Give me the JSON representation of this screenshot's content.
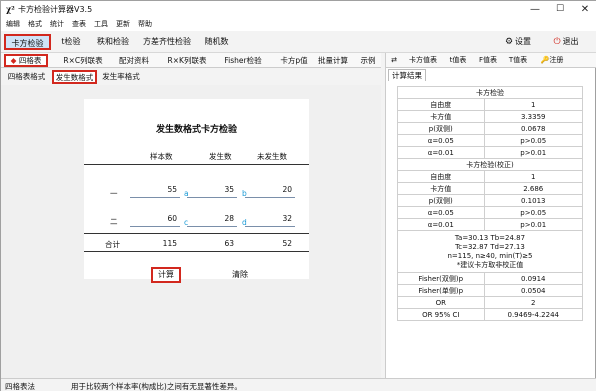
{
  "window": {
    "title": "卡方检验计算器V3.5",
    "icon": "χ²"
  },
  "menu": [
    "编辑",
    "格式",
    "统计",
    "查表",
    "工具",
    "更新",
    "帮助"
  ],
  "toolbar": {
    "tabs": [
      "卡方检验",
      "t检验",
      "秩和检验",
      "方差齐性检验",
      "随机数"
    ],
    "settings": "设置",
    "exit": "退出"
  },
  "subtabs": [
    "四格表",
    "R×C列联表",
    "配对资料",
    "R×K列联表",
    "Fisher检验",
    "卡方p值",
    "批量计算",
    "示例"
  ],
  "formattabs": [
    "四格表格式",
    "发生数格式",
    "发生率格式"
  ],
  "card": {
    "title": "发生数格式卡方检验",
    "headers": [
      "样本数",
      "发生数",
      "未发生数"
    ],
    "rows": [
      {
        "label": "一",
        "n": "55",
        "a_letter": "a",
        "events": "35",
        "b_letter": "b",
        "non": "20"
      },
      {
        "label": "二",
        "n": "60",
        "a_letter": "c",
        "events": "28",
        "b_letter": "d",
        "non": "32"
      }
    ],
    "total": {
      "label": "合计",
      "n": "115",
      "events": "63",
      "non": "52"
    },
    "calc": "计算",
    "clear": "清除"
  },
  "righttabs": [
    "⇄",
    "卡方值表",
    "t值表",
    "F值表",
    "T值表",
    "注册"
  ],
  "result_tab": "计算结果",
  "results": {
    "sec1": "卡方检验",
    "rows1": [
      [
        "自由度",
        "1"
      ],
      [
        "卡方值",
        "3.3359"
      ],
      [
        "p(双侧)",
        "0.0678"
      ],
      [
        "α=0.05",
        "p>0.05"
      ],
      [
        "α=0.01",
        "p>0.01"
      ]
    ],
    "sec2": "卡方检验(校正)",
    "rows2": [
      [
        "自由度",
        "1"
      ],
      [
        "卡方值",
        "2.686"
      ],
      [
        "p(双侧)",
        "0.1013"
      ],
      [
        "α=0.05",
        "p>0.05"
      ],
      [
        "α=0.01",
        "p>0.01"
      ]
    ],
    "note": [
      "Ta=30.13   Tb=24.87",
      "Tc=32.87   Td=27.13",
      "n=115, n≥40, min(T)≥5",
      "*建议卡方取非校正值"
    ],
    "rows3": [
      [
        "Fisher(双侧)p",
        "0.0914"
      ],
      [
        "Fisher(单侧)p",
        "0.0504"
      ],
      [
        "OR",
        "2"
      ],
      [
        "OR 95% CI",
        "0.9469-4.2244"
      ]
    ]
  },
  "status": {
    "left": "四格表法",
    "right": "用于比较两个样本率(构成比)之间有无显著性差异。"
  }
}
